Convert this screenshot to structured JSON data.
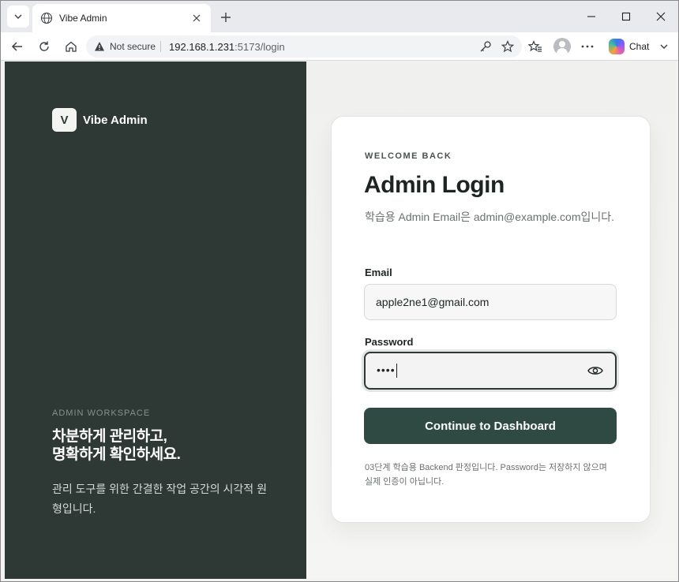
{
  "browser": {
    "tab_title": "Vibe Admin",
    "security_label": "Not secure",
    "url_host": "192.168.1.231",
    "url_path": ":5173/login",
    "chat_label": "Chat"
  },
  "brand": {
    "badge_letter": "V",
    "name": "Vibe Admin"
  },
  "hero": {
    "eyebrow": "ADMIN WORKSPACE",
    "headline_line1": "차분하게 관리하고,",
    "headline_line2": "명확하게 확인하세요.",
    "tagline": "관리 도구를 위한 간결한 작업 공간의 시각적 원형입니다."
  },
  "login": {
    "eyebrow": "WELCOME BACK",
    "title": "Admin Login",
    "description": "학습용 Admin Email은 admin@example.com입니다.",
    "email_label": "Email",
    "email_value": "apple2ne1@gmail.com",
    "password_label": "Password",
    "password_masked": "••••",
    "submit_label": "Continue to Dashboard",
    "footnote": "03단계 학습용 Backend 판정입니다. Password는 저장하지 않으며 실제 인증이 아닙니다."
  },
  "icons": {
    "tab_list": "chevron-down-icon",
    "favicon": "globe-icon",
    "close_tab": "close-icon",
    "new_tab": "plus-icon",
    "back": "arrow-left-icon",
    "reload": "reload-icon",
    "home": "home-icon",
    "warning": "warning-icon",
    "password_key": "key-icon",
    "bookmark": "star-icon",
    "favorites": "favorites-icon",
    "menu": "more-icon",
    "show_password": "eye-icon"
  },
  "colors": {
    "left_panel": "#2e3935",
    "primary_button": "#2e4a42",
    "page_background": "#f1f1ef",
    "card_background": "#ffffff"
  }
}
